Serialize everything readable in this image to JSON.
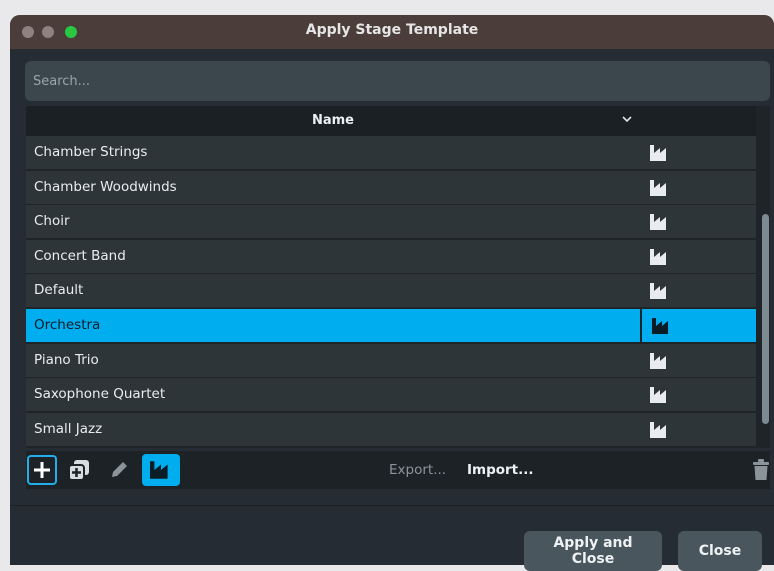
{
  "window": {
    "title": "Apply Stage Template"
  },
  "search": {
    "placeholder": "Search..."
  },
  "table": {
    "column_name": "Name",
    "rows": [
      {
        "label": "Chamber Strings",
        "selected": false
      },
      {
        "label": "Chamber Woodwinds",
        "selected": false
      },
      {
        "label": "Choir",
        "selected": false
      },
      {
        "label": "Concert Band",
        "selected": false
      },
      {
        "label": "Default",
        "selected": false
      },
      {
        "label": "Orchestra",
        "selected": true
      },
      {
        "label": "Piano Trio",
        "selected": false
      },
      {
        "label": "Saxophone Quartet",
        "selected": false
      },
      {
        "label": "Small Jazz",
        "selected": false
      }
    ],
    "row_icon": "factory-stage-icon"
  },
  "toolbar": {
    "export_label": "Export...",
    "import_label": "Import...",
    "icons": [
      "plus-icon",
      "duplicate-icon",
      "pencil-icon",
      "factory-stage-icon",
      "trash-icon"
    ]
  },
  "footer": {
    "apply_label": "Apply and Close",
    "close_label": "Close"
  },
  "colors": {
    "accent": "#00aef0",
    "background": "#262c33",
    "row": "#2e3539"
  }
}
